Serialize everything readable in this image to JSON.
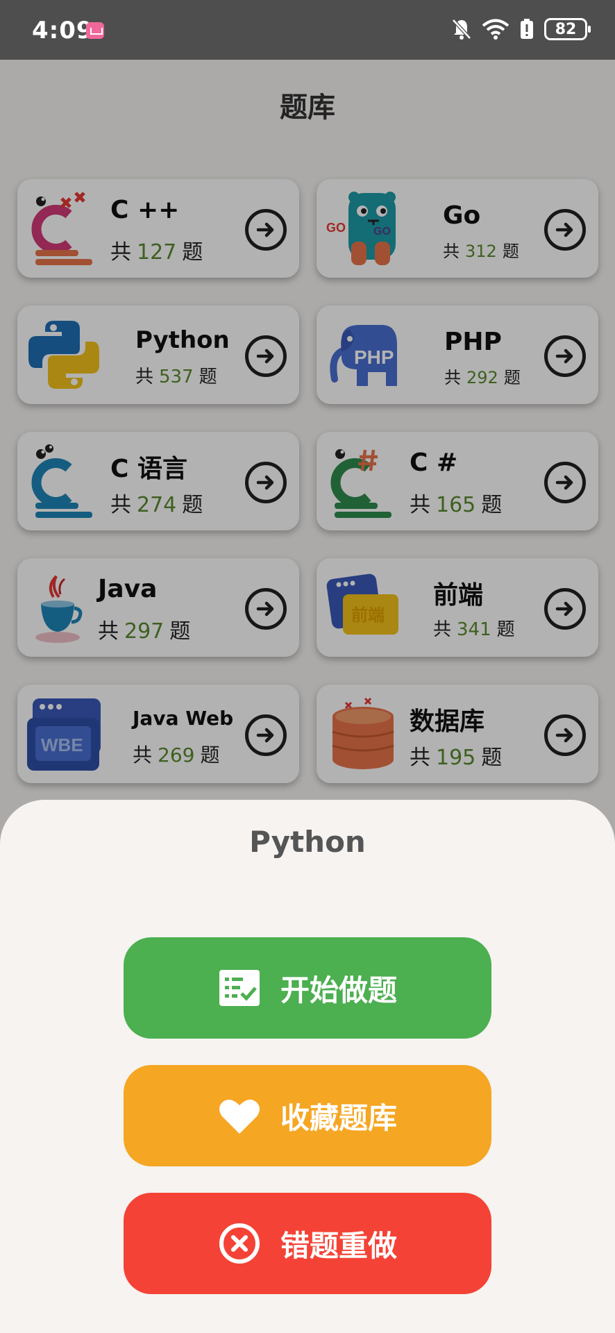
{
  "status": {
    "time": "4:09",
    "battery": "82"
  },
  "page": {
    "title": "题库"
  },
  "card_common": {
    "prefix": "共",
    "suffix": "题"
  },
  "cards": [
    {
      "name": "C ++",
      "count": "127"
    },
    {
      "name": "Go",
      "count": "312"
    },
    {
      "name": "Python",
      "count": "537"
    },
    {
      "name": "PHP",
      "count": "292"
    },
    {
      "name": "C 语言",
      "count": "274"
    },
    {
      "name": "C #",
      "count": "165"
    },
    {
      "name": "Java",
      "count": "297"
    },
    {
      "name": "前端",
      "count": "341"
    },
    {
      "name": "Java Web",
      "count": "269"
    },
    {
      "name": "数据库",
      "count": "195"
    }
  ],
  "logos": {
    "php": "PHP",
    "frontend": "前端",
    "web": "WBE",
    "go": "GO"
  },
  "sheet": {
    "title": "Python",
    "start_label": "开始做题",
    "favorite_label": "收藏题库",
    "redo_label": "错题重做"
  },
  "colors": {
    "start": "#4caf50",
    "favorite": "#f5a623",
    "redo": "#f44336",
    "count_number": "#5a8a2e"
  }
}
